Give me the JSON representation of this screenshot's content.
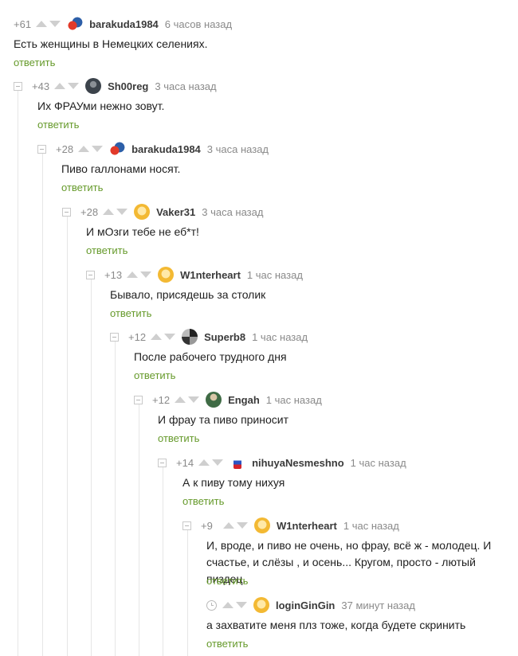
{
  "reply_label": "ответить",
  "colors": {
    "accent_green": "#669a2b",
    "meta_gray": "#8a8a8a",
    "text": "#1f1f1f"
  },
  "comments": [
    {
      "rating": "+61",
      "user": "barakuda1984",
      "time": "6 часов назад",
      "text": "Есть женщины в Немецких селениях.",
      "avatar_icon": "car-avatar-icon"
    },
    {
      "rating": "+43",
      "user": "Sh00reg",
      "time": "3 часа назад",
      "text": "Их ФРАУми нежно зовут.",
      "avatar_icon": "user-avatar-icon"
    },
    {
      "rating": "+28",
      "user": "barakuda1984",
      "time": "3 часа назад",
      "text": "Пиво галлонами носят.",
      "avatar_icon": "car-avatar-icon"
    },
    {
      "rating": "+28",
      "user": "Vaker31",
      "time": "3 часа назад",
      "text": "И мОзги тебе не еб*т!",
      "avatar_icon": "default-avatar-icon"
    },
    {
      "rating": "+13",
      "user": "W1nterheart",
      "time": "1 час назад",
      "text": "Бывало, присядешь за столик",
      "avatar_icon": "default-avatar-icon"
    },
    {
      "rating": "+12",
      "user": "Superb8",
      "time": "1 час назад",
      "text": "После рабочего трудного дня",
      "avatar_icon": "user-avatar-icon"
    },
    {
      "rating": "+12",
      "user": "Engah",
      "time": "1 час назад",
      "text": "И фрау та пиво приносит",
      "avatar_icon": "user-avatar-icon"
    },
    {
      "rating": "+14",
      "user": "nihuyaNesmeshno",
      "time": "1 час назад",
      "text": "А к пиву тому нихуя",
      "avatar_icon": "flag-avatar-icon"
    },
    {
      "rating": "+9",
      "user": "W1nterheart",
      "time": "1 час назад",
      "text_line1": "И, вроде, и пиво не очень, но фрау, всё ж - молодец. И",
      "text_line2": "счастье, и слёзы , и осень... Кругом, просто - лютый пиздец.",
      "avatar_icon": "default-avatar-icon"
    },
    {
      "rating_icon": "clock-icon",
      "user": "loginGinGin",
      "time": "37 минут назад",
      "text": "а захватите меня плз тоже, когда будете скринить",
      "avatar_icon": "default-avatar-icon"
    }
  ]
}
